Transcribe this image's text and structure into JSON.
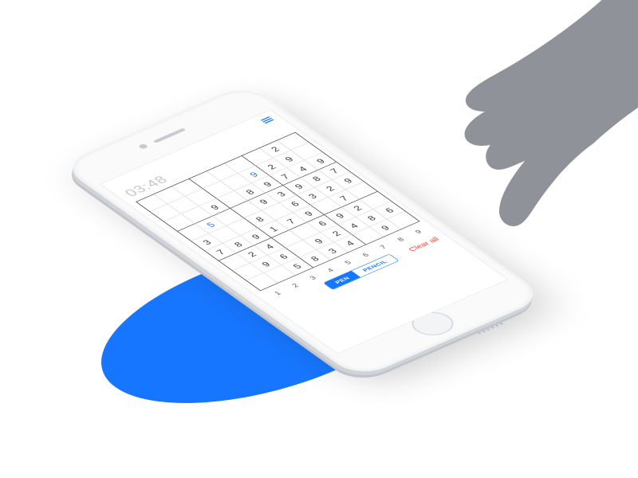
{
  "timer": "03:48",
  "toolbar": {
    "pen_label": "PEN",
    "pencil_label": "PENCIL",
    "clear_label": "Clear all",
    "active_mode": "pen"
  },
  "numpad": [
    "1",
    "2",
    "3",
    "4",
    "5",
    "6",
    "7",
    "8",
    "9"
  ],
  "grid": {
    "rows": [
      [
        null,
        null,
        null,
        null,
        null,
        null,
        null,
        "2",
        null
      ],
      [
        null,
        null,
        null,
        null,
        null,
        {
          "v": "9",
          "user": true
        },
        "2",
        "9",
        null
      ],
      [
        null,
        null,
        "9",
        null,
        "8",
        "9",
        "7",
        "4",
        "9"
      ],
      [
        null,
        {
          "v": "5",
          "user": true
        },
        null,
        null,
        "9",
        "3",
        "9",
        "8",
        "7"
      ],
      [
        "3",
        null,
        null,
        "8",
        null,
        "6",
        "3",
        "2",
        "9"
      ],
      [
        "7",
        "8",
        "9",
        "1",
        "7",
        "9",
        null,
        "7",
        null
      ],
      [
        null,
        "2",
        "4",
        null,
        null,
        "6",
        "9",
        "2",
        null
      ],
      [
        null,
        "9",
        "6",
        null,
        "9",
        "2",
        "4",
        "8",
        "6"
      ],
      [
        null,
        null,
        "5",
        "8",
        "3",
        "4",
        null,
        "9",
        null
      ]
    ]
  },
  "colors": {
    "accent": "#1676ff",
    "danger": "#ff3b30"
  }
}
